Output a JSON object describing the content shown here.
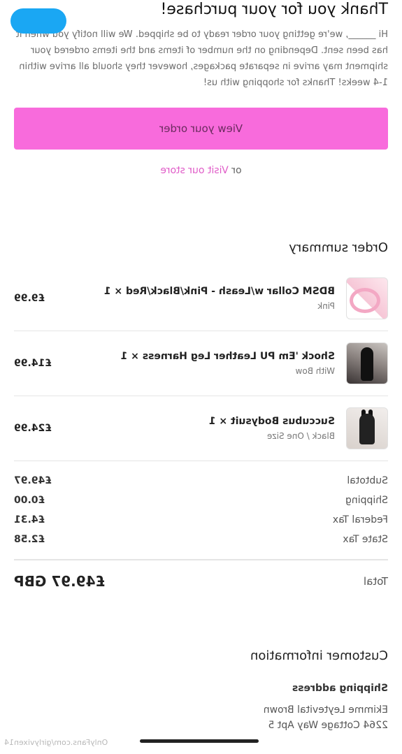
{
  "header": {
    "title": "Thank you for your purchase!",
    "message": "Hi ______, we're getting your order ready to be shipped. We will notify you when it has been sent. Depending on the number of items and the items ordered your shipment may arrive in separate packages, however they should all arrive within 1-4 weeks! Thanks for shopping with us!"
  },
  "actions": {
    "view_order": "View your order",
    "or": "or",
    "visit_store": "Visit our store"
  },
  "summary": {
    "title": "Order summary",
    "items": [
      {
        "name": "BDSM Collar w/Leash - Pink/Black/Red × 1",
        "variant": "Pink",
        "price": "£9.99"
      },
      {
        "name": "Shock 'Em PU Leather Leg Harness × 1",
        "variant": "With Bow",
        "price": "£14.99"
      },
      {
        "name": "Succubus Bodysuit × 1",
        "variant": "Black / One Size",
        "price": "£24.99"
      }
    ],
    "subtotal_label": "Subtotal",
    "subtotal": "£49.97",
    "shipping_label": "Shipping",
    "shipping": "£0.00",
    "federal_tax_label": "Federal Tax",
    "federal_tax": "£4.31",
    "state_tax_label": "State Tax",
    "state_tax": "£2.58",
    "total_label": "Total",
    "total": "£49.97 GBP"
  },
  "customer": {
    "title": "Customer information",
    "shipping_address_label": "Shipping address",
    "name": "Ekimme Leytevital Brown",
    "street": "2264 Cottage Way Apt 5"
  },
  "watermark": "OnlyFans.com/girlyvixen14",
  "colors": {
    "accent": "#f86bdc",
    "link": "#e05cc8"
  }
}
